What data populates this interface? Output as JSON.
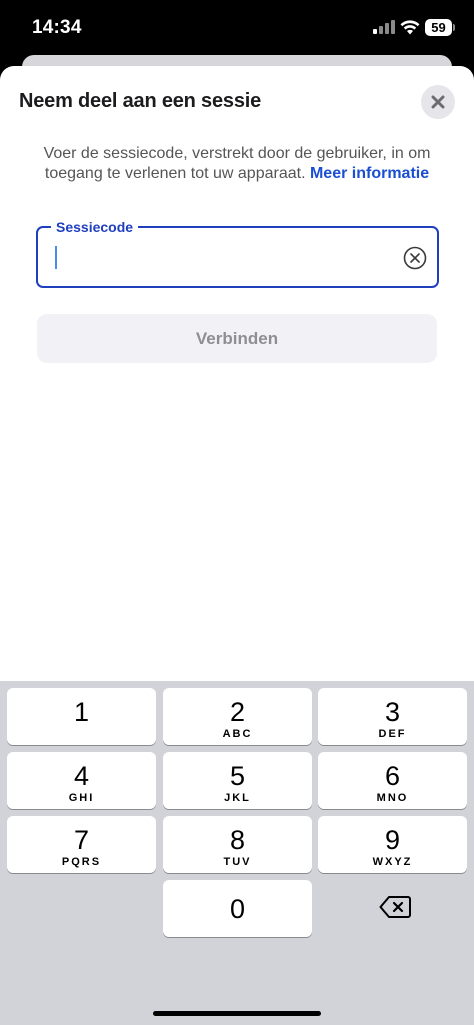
{
  "status": {
    "time": "14:34",
    "battery": "59"
  },
  "sheet": {
    "title": "Neem deel aan een sessie",
    "description_text": "Voer de sessiecode, verstrekt door de gebruiker, in om toegang te verlenen tot uw apparaat.",
    "more_info_link": "Meer informatie"
  },
  "session_field": {
    "label": "Sessiecode",
    "value": "",
    "placeholder": ""
  },
  "connect_button": {
    "label": "Verbinden"
  },
  "keypad": {
    "keys": [
      {
        "num": "1",
        "letters": ""
      },
      {
        "num": "2",
        "letters": "ABC"
      },
      {
        "num": "3",
        "letters": "DEF"
      },
      {
        "num": "4",
        "letters": "GHI"
      },
      {
        "num": "5",
        "letters": "JKL"
      },
      {
        "num": "6",
        "letters": "MNO"
      },
      {
        "num": "7",
        "letters": "PQRS"
      },
      {
        "num": "8",
        "letters": "TUV"
      },
      {
        "num": "9",
        "letters": "WXYZ"
      },
      {
        "num": "0",
        "letters": ""
      }
    ]
  }
}
